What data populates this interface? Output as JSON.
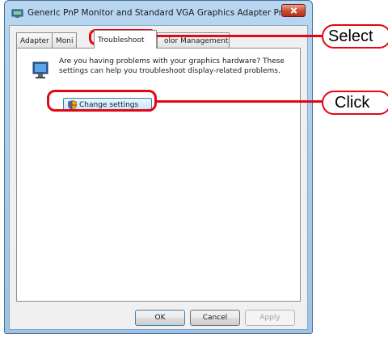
{
  "window": {
    "title": "Generic PnP Monitor and Standard VGA Graphics Adapter Prope...",
    "icon": "display-adapter-icon"
  },
  "tabs": [
    {
      "label": "Adapter",
      "active": false
    },
    {
      "label": "Moni",
      "active": false
    },
    {
      "label": "Troubleshoot",
      "active": true
    },
    {
      "label": "olor Management",
      "active": false
    }
  ],
  "panel": {
    "description_line1": "Are you having problems with your graphics hardware? These",
    "description_line2": "settings can help you troubleshoot display-related problems.",
    "change_settings_label": "Change settings"
  },
  "buttons": {
    "ok": "OK",
    "cancel": "Cancel",
    "apply": "Apply"
  },
  "callouts": {
    "select": "Select",
    "click": "Click"
  },
  "colors": {
    "highlight": "#e30613",
    "title_gradient": "#b8d6f0"
  }
}
